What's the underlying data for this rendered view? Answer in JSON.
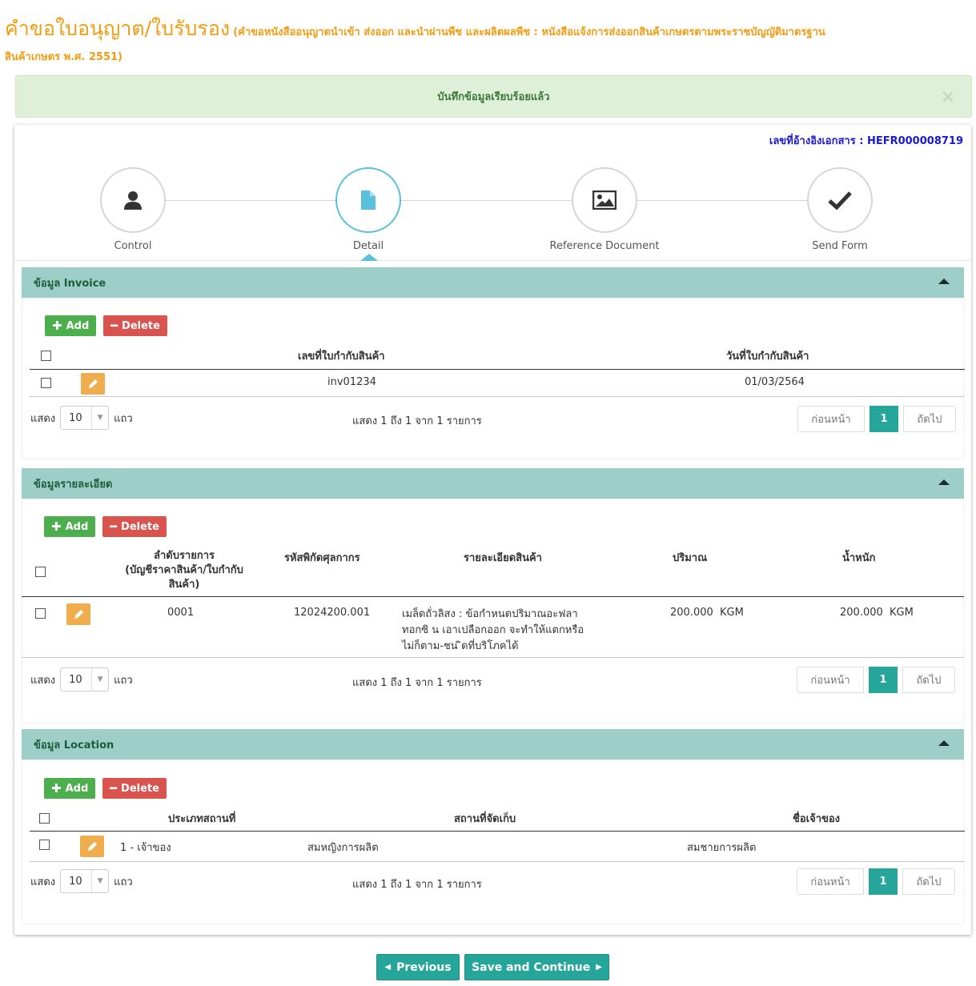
{
  "page": {
    "title": "คำขอใบอนุญาต/ใบรับรอง",
    "subtitle_line1": "(คำขอหนังสืออนุญาตนำเข้า ส่งออก และนำผ่านพืช และผลิตผลพืช : หนังสือแจ้งการส่งออกสินค้าเกษตรตามพระราชบัญญัติมาตรฐาน",
    "subtitle_line2": "สินค้าเกษตร พ.ศ. 2551)"
  },
  "alert": {
    "message": "บันทึกข้อมูลเรียบร้อยแล้ว",
    "close": "×"
  },
  "reference": {
    "label": "เลขที่อ้างอิงเอกสาร : HEFR000008719"
  },
  "wizard": {
    "steps": [
      {
        "label": "Control",
        "icon": "user-icon"
      },
      {
        "label": "Detail",
        "icon": "file-icon",
        "active": true
      },
      {
        "label": "Reference Document",
        "icon": "image-icon"
      },
      {
        "label": "Send Form",
        "icon": "check-icon"
      }
    ]
  },
  "buttons": {
    "add": "Add",
    "delete": "Delete"
  },
  "invoice": {
    "title": "ข้อมูล Invoice",
    "columns": [
      "เลขที่ใบกำกับสินค้า",
      "วันที่ใบกำกับสินค้า"
    ],
    "rows": [
      {
        "invoice_no": "inv01234",
        "invoice_date": "01/03/2564"
      }
    ],
    "footer": {
      "show": "แสดง",
      "page_size": "10",
      "rows_word": "แถว",
      "info": "แสดง 1 ถึง 1 จาก 1 รายการ",
      "prev": "ก่อนหน้า",
      "page": "1",
      "next": "ถัดไป"
    }
  },
  "detail": {
    "title": "ข้อมูลรายละเอียด",
    "columns": [
      "ลำดับรายการ",
      "(บัญชีราคาสินค้า/ใบกำกับ",
      "สินค้า)",
      "รหัสพิกัดศุลกากร",
      "รายละเอียดสินค้า",
      "ปริมาณ",
      "น้ำหนัก"
    ],
    "rows": [
      {
        "seq": "0001",
        "hs_code": "12024200.001",
        "desc_line1": "เมล็ดถั่วลิสง : ข้อกำหนดปริมาณอะฟลา",
        "desc_line2": "ทอกซิ น เอาเปลือกออก จะทำให้แตกหรือ",
        "desc_line3": "ไม่ก็ตาม-ชน ิดที่บริโภคได้",
        "quantity": "200.000  KGM",
        "weight": "200.000  KGM"
      }
    ],
    "footer": {
      "show": "แสดง",
      "page_size": "10",
      "rows_word": "แถว",
      "info": "แสดง 1 ถึง 1 จาก 1 รายการ",
      "prev": "ก่อนหน้า",
      "page": "1",
      "next": "ถัดไป"
    }
  },
  "location": {
    "title": "ข้อมูล Location",
    "columns": [
      "ประเภทสถานที่",
      "สถานที่จัดเก็บ",
      "ชื่อเจ้าของ"
    ],
    "rows": [
      {
        "type": "1 - เจ้าของ",
        "storage": "สมหญิงการผลิต",
        "owner": "สมชายการผลิต"
      }
    ],
    "footer": {
      "show": "แสดง",
      "page_size": "10",
      "rows_word": "แถว",
      "info": "แสดง 1 ถึง 1 จาก 1 รายการ",
      "prev": "ก่อนหน้า",
      "page": "1",
      "next": "ถัดไป"
    }
  },
  "nav": {
    "previous": "Previous",
    "save_continue": "Save and Continue"
  },
  "colors": {
    "accent": "#f39c12",
    "teal": "#26a69a",
    "section_header": "#9dcec8",
    "add": "#4cae4c",
    "delete": "#d9534f",
    "edit": "#f0ad4e",
    "ref": "#1919d4"
  }
}
